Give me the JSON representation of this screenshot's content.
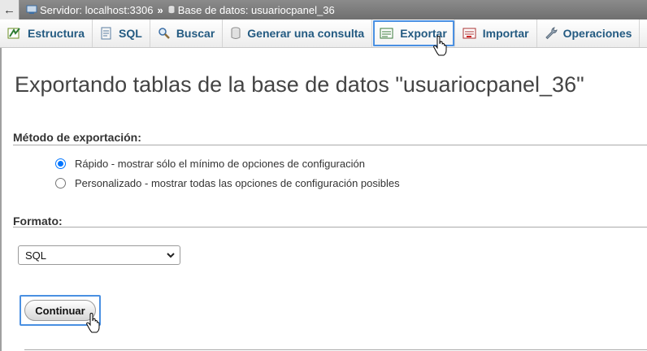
{
  "breadcrumb": {
    "back": "←",
    "server": "Servidor: localhost:3306",
    "separator": "»",
    "database": "Base de datos: usuariocpanel_36"
  },
  "tabs": [
    {
      "label": "Estructura",
      "icon": "structure-icon"
    },
    {
      "label": "SQL",
      "icon": "sql-icon"
    },
    {
      "label": "Buscar",
      "icon": "search-icon"
    },
    {
      "label": "Generar una consulta",
      "icon": "query-icon"
    },
    {
      "label": "Exportar",
      "icon": "export-icon",
      "active": true
    },
    {
      "label": "Importar",
      "icon": "import-icon"
    },
    {
      "label": "Operaciones",
      "icon": "wrench-icon"
    }
  ],
  "main": {
    "title": "Exportando tablas de la base de datos \"usuariocpanel_36\"",
    "method_heading": "Método de exportación:",
    "method_options": [
      {
        "label": "Rápido - mostrar sólo el mínimo de opciones de configuración",
        "checked": true
      },
      {
        "label": "Personalizado - mostrar todas las opciones de configuración posibles",
        "checked": false
      }
    ],
    "format_heading": "Formato:",
    "format_value": "SQL",
    "continue_label": "Continuar"
  },
  "colors": {
    "accent": "#4a90e2",
    "tab_text": "#235a81",
    "breadcrumb_bg": "#7c7c7c"
  }
}
